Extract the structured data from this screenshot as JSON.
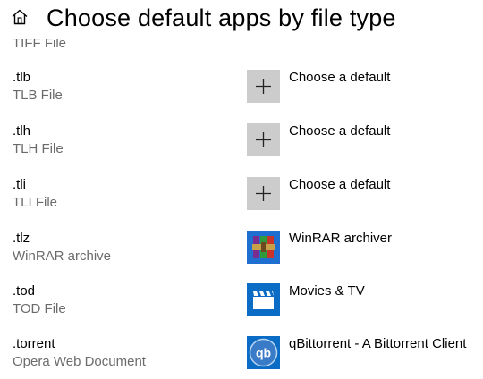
{
  "header": {
    "title": "Choose default apps by file type"
  },
  "rows": [
    {
      "ext": "",
      "type": "TIFF File",
      "app": ""
    },
    {
      "ext": ".tlb",
      "type": "TLB File",
      "app": "Choose a default",
      "icon": "plus-icon"
    },
    {
      "ext": ".tlh",
      "type": "TLH File",
      "app": "Choose a default",
      "icon": "plus-icon"
    },
    {
      "ext": ".tli",
      "type": "TLI File",
      "app": "Choose a default",
      "icon": "plus-icon"
    },
    {
      "ext": ".tlz",
      "type": "WinRAR archive",
      "app": "WinRAR archiver",
      "icon": "winrar-icon"
    },
    {
      "ext": ".tod",
      "type": "TOD File",
      "app": "Movies & TV",
      "icon": "movies-tv-icon"
    },
    {
      "ext": ".torrent",
      "type": "Opera Web Document",
      "app": "qBittorrent - A Bittorrent Client",
      "icon": "qbittorrent-icon",
      "icon_text": "qb"
    }
  ]
}
